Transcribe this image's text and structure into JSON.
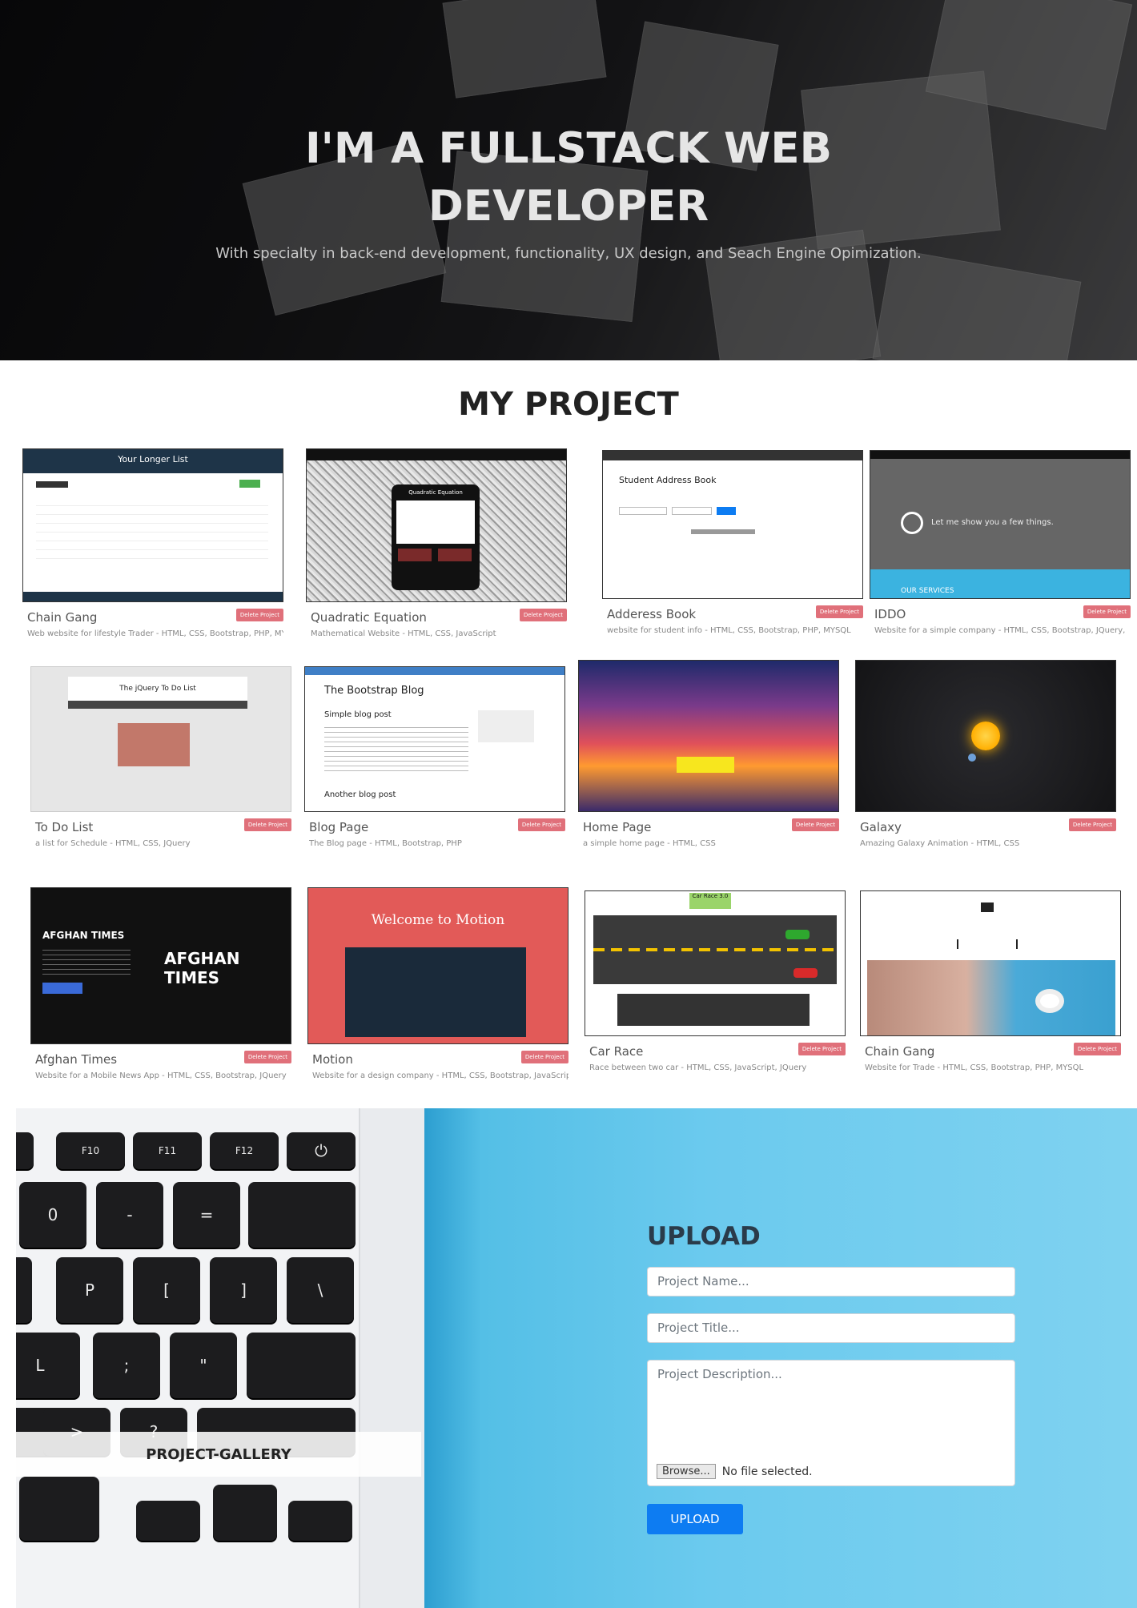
{
  "hero": {
    "title_line1": "I'M A FULLSTACK WEB",
    "title_line2": "DEVELOPER",
    "subtitle": "With specialty in back-end development, functionality, UX design, and Seach Engine Opimization."
  },
  "projects": {
    "heading": "MY PROJECT",
    "delete_label": "Delete Project",
    "items": [
      {
        "title": "Chain Gang",
        "desc": "Web website for lifestyle Trader - HTML, CSS, Bootstrap, PHP, MYSQL",
        "thumb": "your-todo-list"
      },
      {
        "title": "Quadratic Equation",
        "desc": "Mathematical Website - HTML, CSS, JavaScript",
        "thumb": "quadratic-calc"
      },
      {
        "title": "Adderess Book",
        "desc": "website for student info - HTML, CSS, Bootstrap, PHP, MYSQL",
        "thumb": "student-address-book"
      },
      {
        "title": "IDDO",
        "desc": "Website for a simple company - HTML, CSS, Bootstrap, JQuery,",
        "thumb": "company-landing"
      },
      {
        "title": "To Do List",
        "desc": "a list for Schedule - HTML, CSS, JQuery",
        "thumb": "jquery-todo"
      },
      {
        "title": "Blog Page",
        "desc": "The Blog page - HTML, Bootstrap, PHP",
        "thumb": "bootstrap-blog"
      },
      {
        "title": "Home Page",
        "desc": "a simple home page - HTML, CSS",
        "thumb": "sunset-home"
      },
      {
        "title": "Galaxy",
        "desc": "Amazing Galaxy Animation - HTML, CSS",
        "thumb": "galaxy-sun"
      },
      {
        "title": "Afghan Times",
        "desc": "Website for a Mobile News App - HTML, CSS, Bootstrap, JQuery",
        "thumb": "afghan-times"
      },
      {
        "title": "Motion",
        "desc": "Website for a design company - HTML, CSS, Bootstrap, JavaScript",
        "thumb": "welcome-motion"
      },
      {
        "title": "Car Race",
        "desc": "Race between two car - HTML, CSS, JavaScript, JQuery",
        "thumb": "car-race"
      },
      {
        "title": "Chain Gang",
        "desc": "Website for Trade - HTML, CSS, Bootstrap, PHP, MYSQL",
        "thumb": "laptop-coffee"
      }
    ]
  },
  "thumbs_text": {
    "todo_header": "Your Longer List",
    "quad_title": "Quadratic Equation",
    "address_title": "Student Address Book",
    "iddo_text": "Let me show you a few things.",
    "iddo_services": "OUR SERVICES",
    "jquery_todo": "The jQuery To Do List",
    "blog_title": "The Bootstrap Blog",
    "blog_post1": "Simple blog post",
    "blog_post2": "Another blog post",
    "afghan_title": "AFGHAN TIMES",
    "afghan_logo": "AFGHAN TIMES",
    "motion_title": "Welcome to Motion",
    "car_race_title": "Car Race 3.0"
  },
  "gallery": {
    "label": "PROJECT-GALLERY",
    "keys": [
      "F10",
      "F11",
      "F12",
      "0",
      "-",
      "=",
      "P",
      "[",
      "]",
      "\\",
      "L",
      ";",
      "\"",
      ">",
      "?"
    ]
  },
  "upload": {
    "title": "UPLOAD",
    "name_placeholder": "Project Name...",
    "title_placeholder": "Project Title...",
    "desc_placeholder": "Project Description...",
    "browse_label": "Browse...",
    "file_status": "No file selected.",
    "button_label": "UPLOAD"
  },
  "colors": {
    "delete_button": "#e0707a",
    "upload_button": "#0d7cf2",
    "panel_blue": "#6bcaee"
  }
}
